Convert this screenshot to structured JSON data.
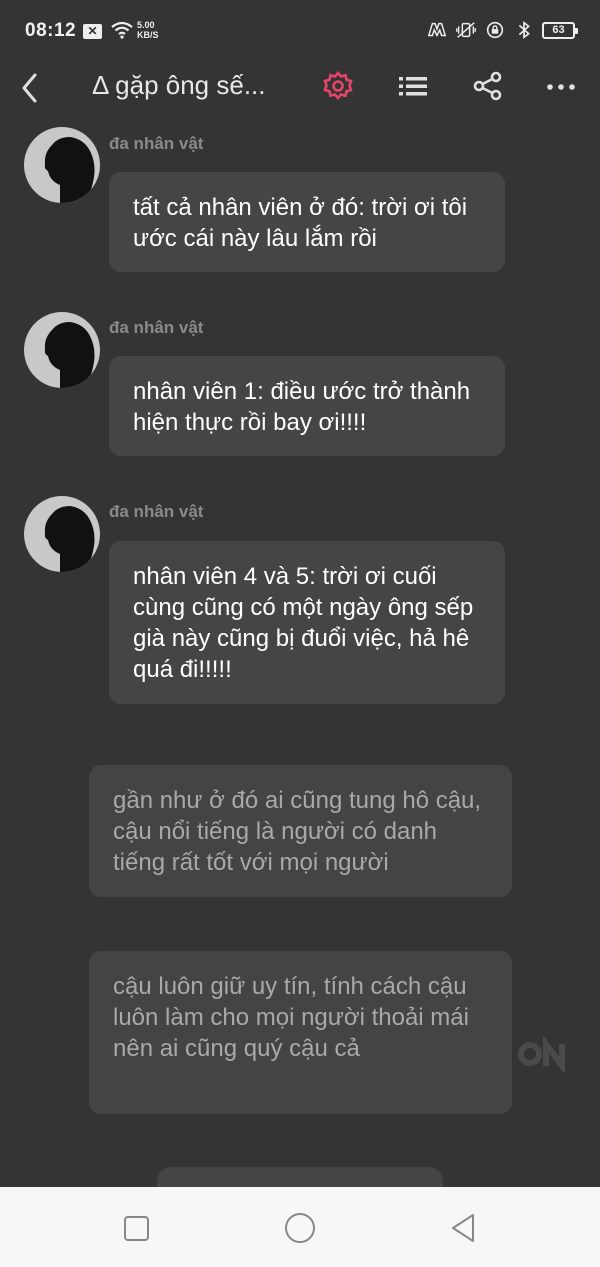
{
  "status_bar": {
    "time": "08:12",
    "speed_value": "5.00",
    "speed_unit": "KB/S",
    "battery": "63"
  },
  "header": {
    "title": "Δ gặp ông sế..."
  },
  "messages": [
    {
      "sender": "đa nhân vật",
      "text": "tất cả nhân viên ở đó: trời ơi tôi ước cái này lâu lắm rồi"
    },
    {
      "sender": "đa nhân vật",
      "text": "nhân viên 1: điều ước trở thành hiện thực rồi bay ơi!!!!"
    },
    {
      "sender": "đa nhân vật",
      "text": "nhân viên 4 và 5: trời ơi cuối cùng cũng có một ngày ông sếp già này cũng bị đuổi việc, hả hê quá đi!!!!!"
    }
  ],
  "narration": [
    {
      "text": "gần như ở đó ai cũng tung hô cậu, cậu nổi tiếng là người có danh tiếng rất tốt với mọi người"
    },
    {
      "text": "cậu luôn giữ uy tín, tính cách cậu luôn làm cho mọi người thoải mái nên ai cũng quý cậu cả"
    }
  ],
  "colors": {
    "background": "#343434",
    "bubble": "#454545",
    "accent_settings": "#e8436a",
    "nav_bar": "#f7f7f7"
  },
  "icons": [
    "back-icon",
    "settings-icon",
    "list-icon",
    "share-icon",
    "more-icon",
    "square-icon",
    "circle-icon",
    "triangle-back-icon"
  ]
}
